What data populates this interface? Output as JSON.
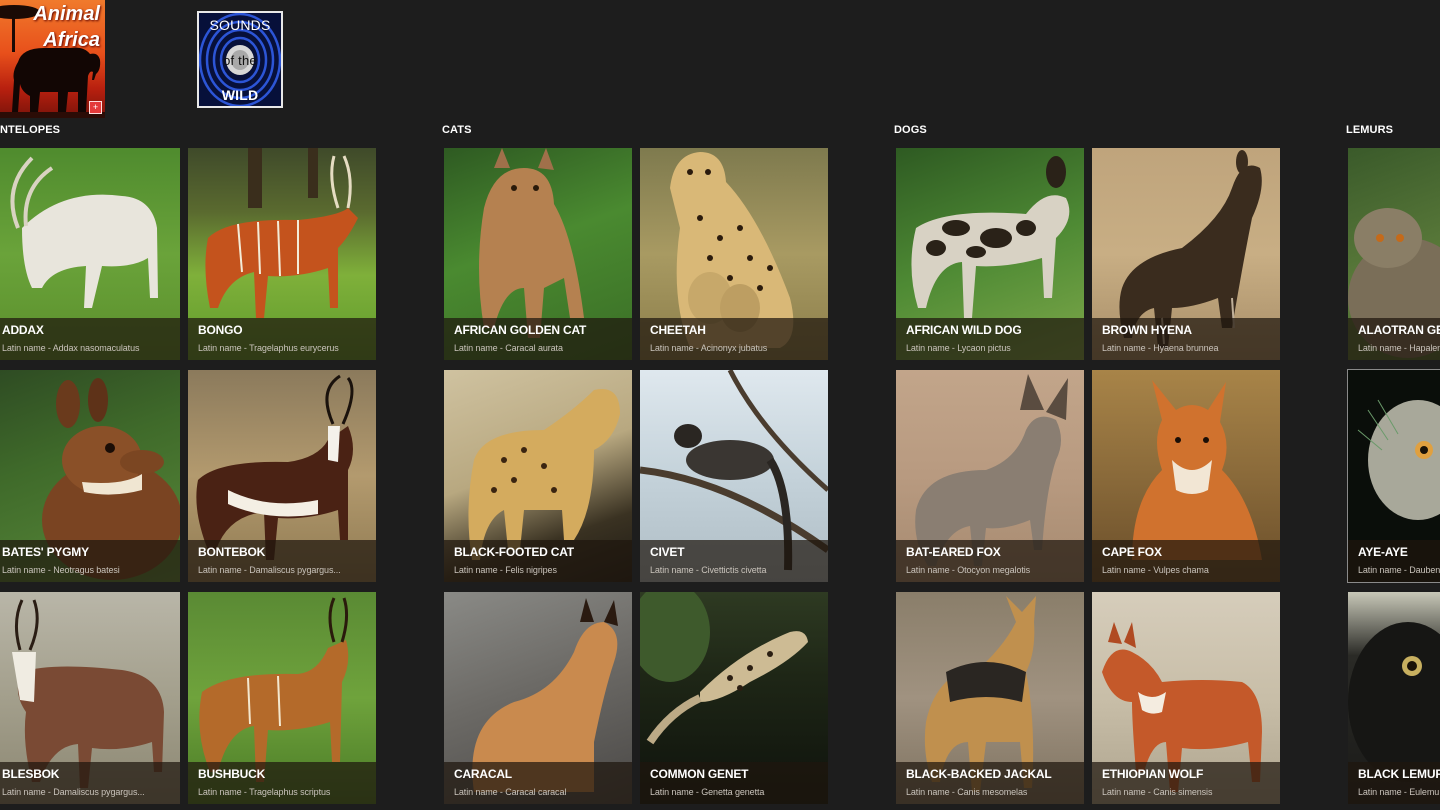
{
  "logos": {
    "animal_africa": {
      "line1": "Animal",
      "line2": "Africa"
    },
    "sounds_of_the_wild": {
      "line1": "SOUNDS",
      "line2": "of the",
      "line3": "WILD"
    }
  },
  "groups": [
    {
      "id": "antelopes",
      "header": "NTELOPES",
      "tiles": [
        {
          "name": "ADDAX",
          "latin": "Latin name - Addax nasomaculatus",
          "photo": "addax-photo"
        },
        {
          "name": "BONGO",
          "latin": "Latin name - Tragelaphus eurycerus",
          "photo": "bongo-photo"
        },
        {
          "name": "BATES' PYGMY",
          "latin": "Latin name - Neotragus batesi",
          "photo": "bates-pygmy-photo"
        },
        {
          "name": "BONTEBOK",
          "latin": "Latin name - Damaliscus pygargus...",
          "photo": "bontebok-photo"
        },
        {
          "name": "BLESBOK",
          "latin": "Latin name - Damaliscus pygargus...",
          "photo": "blesbok-photo"
        },
        {
          "name": "BUSHBUCK",
          "latin": "Latin name - Tragelaphus scriptus",
          "photo": "bushbuck-photo"
        }
      ]
    },
    {
      "id": "cats",
      "header": "CATS",
      "tiles": [
        {
          "name": "AFRICAN GOLDEN CAT",
          "latin": "Latin name - Caracal aurata",
          "photo": "golden-cat-photo"
        },
        {
          "name": "CHEETAH",
          "latin": "Latin name - Acinonyx jubatus",
          "photo": "cheetah-photo"
        },
        {
          "name": "BLACK-FOOTED CAT",
          "latin": "Latin name - Felis nigripes",
          "photo": "black-footed-cat-photo"
        },
        {
          "name": "CIVET",
          "latin": "Latin name - Civettictis civetta",
          "photo": "civet-photo"
        },
        {
          "name": "CARACAL",
          "latin": "Latin name - Caracal caracal",
          "photo": "caracal-photo"
        },
        {
          "name": "COMMON GENET",
          "latin": "Latin name - Genetta genetta",
          "photo": "genet-photo"
        }
      ]
    },
    {
      "id": "dogs",
      "header": "DOGS",
      "tiles": [
        {
          "name": "AFRICAN WILD DOG",
          "latin": "Latin name - Lycaon pictus",
          "photo": "wild-dog-photo"
        },
        {
          "name": "BROWN HYENA",
          "latin": "Latin name - Hyaena brunnea",
          "photo": "brown-hyena-photo"
        },
        {
          "name": "BAT-EARED FOX",
          "latin": "Latin name - Otocyon megalotis",
          "photo": "bat-eared-fox-photo"
        },
        {
          "name": "CAPE FOX",
          "latin": "Latin name - Vulpes chama",
          "photo": "cape-fox-photo"
        },
        {
          "name": "BLACK-BACKED JACKAL",
          "latin": "Latin name - Canis mesomelas",
          "photo": "jackal-photo"
        },
        {
          "name": "ETHIOPIAN WOLF",
          "latin": "Latin name - Canis simensis",
          "photo": "ethiopian-wolf-photo"
        }
      ]
    },
    {
      "id": "lemurs",
      "header": "LEMURS",
      "tiles": [
        {
          "name": "ALAOTRAN GEN",
          "latin": "Latin name - Hapalem",
          "photo": "alaotran-photo"
        },
        {
          "name": "AYE-AYE",
          "latin": "Latin name - Dauben",
          "photo": "aye-aye-photo",
          "selected": true
        },
        {
          "name": "BLACK LEMUR",
          "latin": "Latin name - Eulemu",
          "photo": "black-lemur-photo"
        }
      ]
    }
  ]
}
